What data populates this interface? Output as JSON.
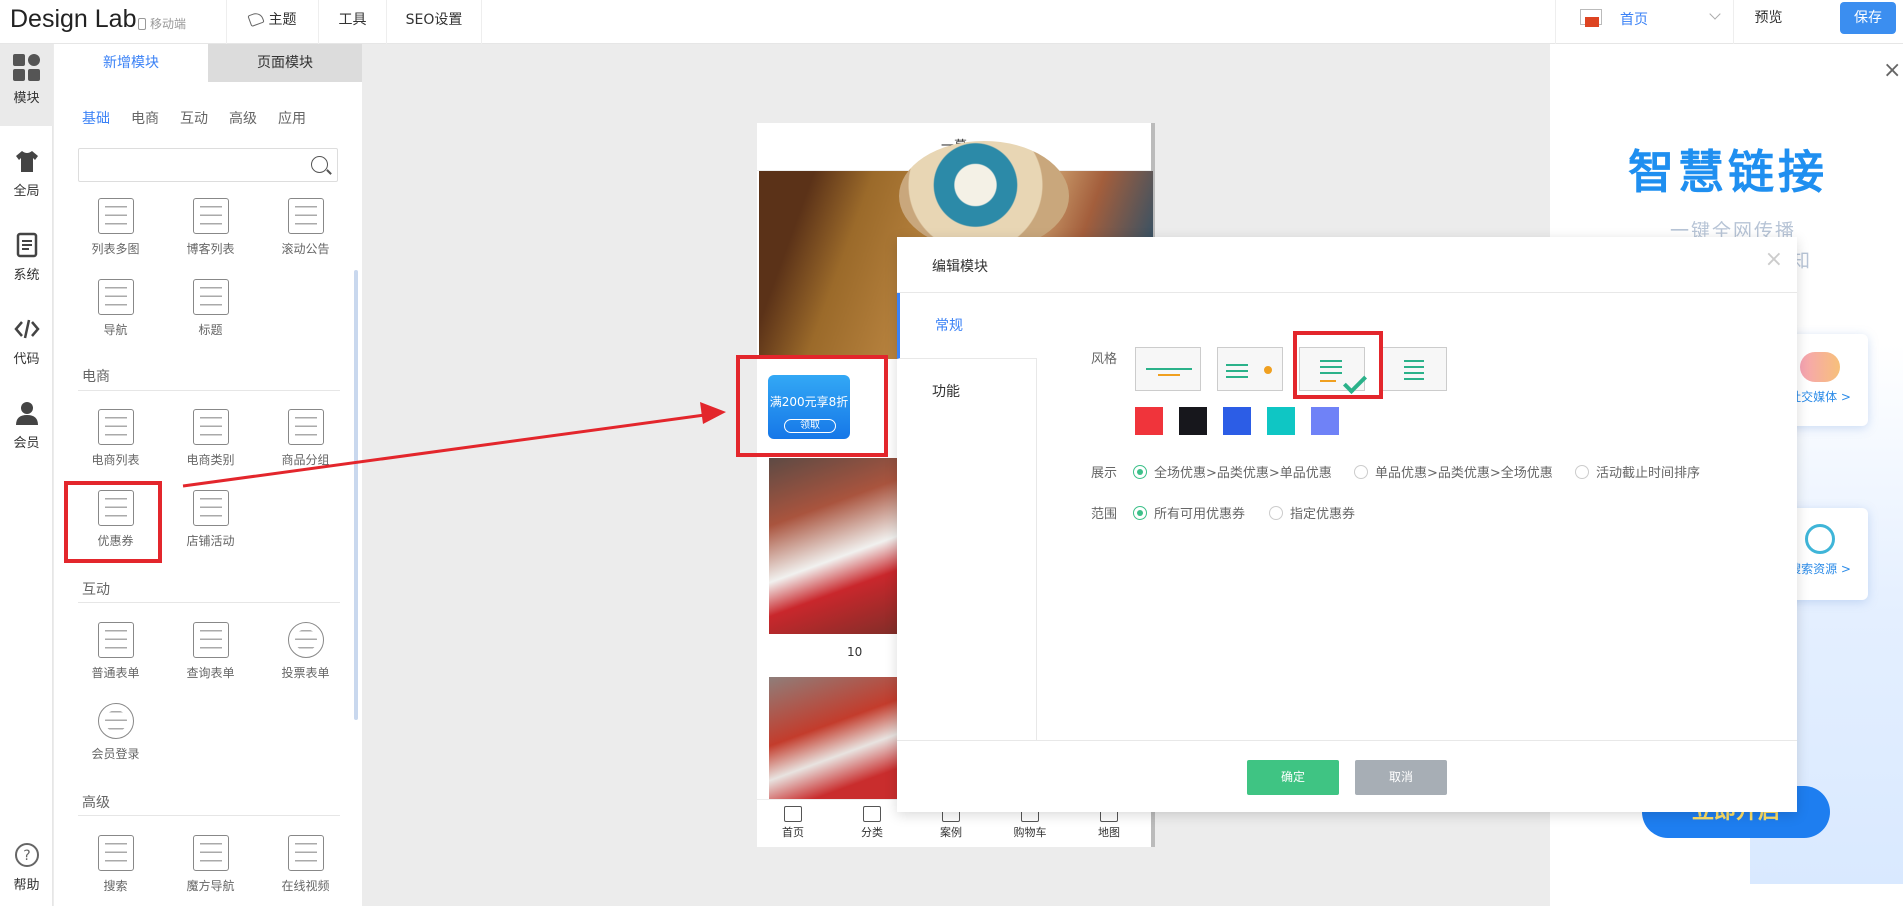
{
  "topbar": {
    "brand": "Design Lab",
    "mobile": "移动端",
    "nav": [
      "主题",
      "工具",
      "SEO设置"
    ],
    "lang": "首页",
    "preview": "预览",
    "save": "保存"
  },
  "iconbar": {
    "items": [
      "模块",
      "全局",
      "系统",
      "代码",
      "会员"
    ],
    "help": "帮助"
  },
  "panel": {
    "tabs": [
      "新增模块",
      "页面模块"
    ],
    "cats": [
      "基础",
      "电商",
      "互动",
      "高级",
      "应用"
    ],
    "basic": [
      "列表多图",
      "博客列表",
      "滚动公告",
      "导航",
      "标题"
    ],
    "ecom_title": "电商",
    "ecom": [
      "电商列表",
      "电商类别",
      "商品分组",
      "优惠券",
      "店铺活动"
    ],
    "interact_title": "互动",
    "interact": [
      "普通表单",
      "查询表单",
      "投票表单",
      "会员登录"
    ],
    "adv_title": "高级",
    "adv": [
      "搜索",
      "魔方导航",
      "在线视频"
    ]
  },
  "phone": {
    "title": "一幕",
    "coupon_text": "满200元享8折",
    "coupon_btn": "领取",
    "num": "10",
    "tabs": [
      "首页",
      "分类",
      "案例",
      "购物车",
      "地图"
    ]
  },
  "modal": {
    "title": "编辑模块",
    "close": "×",
    "tabs": [
      "常规",
      "功能"
    ],
    "style_label": "风格",
    "swatches": [
      "#f0343b",
      "#17171c",
      "#2c5de6",
      "#0fc6c4",
      "#6f82f7"
    ],
    "show_label": "展示",
    "show_opts": [
      "全场优惠>品类优惠>单品优惠",
      "单品优惠>品类优惠>全场优惠",
      "活动截止时间排序"
    ],
    "range_label": "范围",
    "range_opts": [
      "所有可用优惠券",
      "指定优惠券"
    ],
    "ok": "确定",
    "cancel": "取消"
  },
  "ad": {
    "title": "智慧链接",
    "sub1": "一键全网传播",
    "sub2": "皆知",
    "card1": "社交媒体 >",
    "card2": "搜索资源 >",
    "btn": "立即开启",
    "close": "×"
  }
}
